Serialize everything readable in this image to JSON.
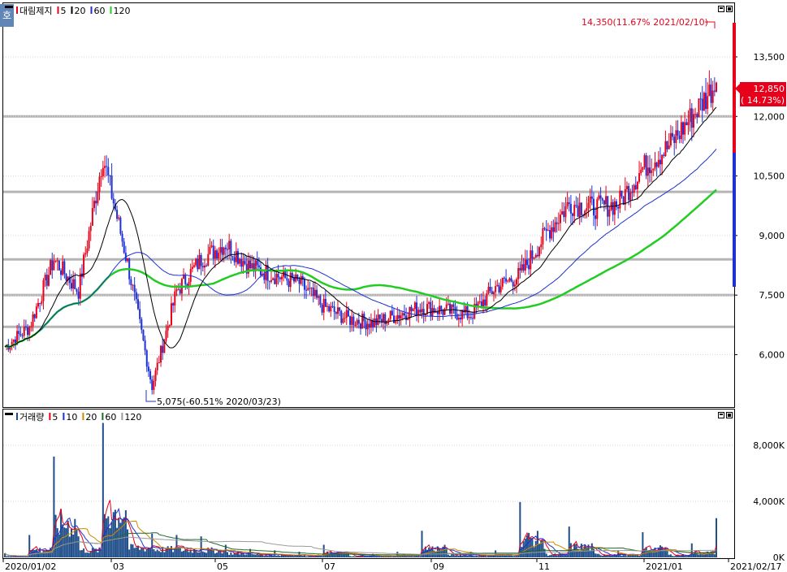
{
  "price_panel": {
    "badge": "호",
    "legend": [
      {
        "text": "대림제지",
        "color": "#000000",
        "marker": "#e8001a"
      },
      {
        "text": "5",
        "color": "#000000",
        "marker": "#e8001a"
      },
      {
        "text": "20",
        "color": "#000000",
        "marker": "#000000"
      },
      {
        "text": "60",
        "color": "#000000",
        "marker": "#1f2fd6"
      },
      {
        "text": "120",
        "color": "#000000",
        "marker": "#22cc22"
      }
    ],
    "max_annotation": "14,350(11.67% 2021/02/10)",
    "min_annotation": "5,075(-60.51% 2020/03/23)",
    "current_price": "12,850",
    "current_change": "( 14.73%)"
  },
  "volume_panel": {
    "legend": [
      {
        "text": "거래량",
        "color": "#000000",
        "marker": "#1f4e8a"
      },
      {
        "text": "5",
        "color": "#000000",
        "marker": "#e8001a"
      },
      {
        "text": "10",
        "color": "#000000",
        "marker": "#1f2fd6"
      },
      {
        "text": "20",
        "color": "#000000",
        "marker": "#d08a00"
      },
      {
        "text": "60",
        "color": "#000000",
        "marker": "#1d6b2c"
      },
      {
        "text": "120",
        "color": "#000000",
        "marker": "#9a9a9a"
      }
    ]
  },
  "x_labels": [
    "2020/01/02",
    "03",
    "05",
    "07",
    "09",
    "11",
    "2021/01",
    "2021/02/17"
  ],
  "chart_data": [
    {
      "type": "candlestick",
      "title": "대림제지",
      "y_ticks": [
        "13,500",
        "12,000",
        "10,500",
        "9,000",
        "7,500",
        "6,000"
      ],
      "ylim": [
        5000,
        14400
      ],
      "moving_averages": [
        5,
        20,
        60,
        120
      ],
      "x": [
        "2020/01/02",
        "2020/01/16",
        "2020/02/03",
        "2020/02/17",
        "2020/03/02",
        "2020/03/16",
        "2020/03/23",
        "2020/04/01",
        "2020/04/16",
        "2020/05/04",
        "2020/05/18",
        "2020/06/01",
        "2020/06/15",
        "2020/07/01",
        "2020/07/15",
        "2020/08/03",
        "2020/08/18",
        "2020/09/01",
        "2020/09/15",
        "2020/10/05",
        "2020/10/19",
        "2020/11/02",
        "2020/11/16",
        "2020/12/01",
        "2020/12/15",
        "2021/01/04",
        "2021/01/18",
        "2021/02/01",
        "2021/02/10",
        "2021/02/17"
      ],
      "close": [
        6200,
        6700,
        8400,
        7600,
        11000,
        8300,
        5200,
        7600,
        8400,
        8800,
        8200,
        8000,
        7800,
        7200,
        6900,
        6800,
        7000,
        7200,
        7100,
        7000,
        7700,
        8000,
        9000,
        9800,
        9700,
        9800,
        10700,
        11200,
        12000,
        12850
      ],
      "high_annotation": {
        "value": 14350,
        "label": "14,350(11.67% 2021/02/10)"
      },
      "low_annotation": {
        "value": 5075,
        "label": "5,075(-60.51% 2020/03/23)"
      },
      "last": {
        "value": 12850,
        "change": "14.73%"
      }
    },
    {
      "type": "bar",
      "title": "거래량",
      "y_ticks": [
        "8,000K",
        "4,000K",
        "0K"
      ],
      "ylim": [
        0,
        10000
      ],
      "x": [
        "2020/01/02",
        "2020/01/16",
        "2020/02/03",
        "2020/02/17",
        "2020/03/02",
        "2020/03/16",
        "2020/03/23",
        "2020/04/01",
        "2020/04/16",
        "2020/05/04",
        "2020/05/18",
        "2020/06/01",
        "2020/06/15",
        "2020/07/01",
        "2020/07/15",
        "2020/08/03",
        "2020/08/18",
        "2020/09/01",
        "2020/09/15",
        "2020/10/05",
        "2020/10/19",
        "2020/11/02",
        "2020/11/16",
        "2020/12/01",
        "2020/12/15",
        "2021/01/04",
        "2021/01/18",
        "2021/02/01",
        "2021/02/10",
        "2021/02/17"
      ],
      "values": [
        300,
        1600,
        7200,
        1500,
        9600,
        2000,
        1700,
        1600,
        1500,
        900,
        600,
        500,
        400,
        900,
        300,
        250,
        400,
        1900,
        600,
        400,
        500,
        3950,
        600,
        2200,
        600,
        500,
        1800,
        500,
        1000,
        2800
      ]
    }
  ]
}
